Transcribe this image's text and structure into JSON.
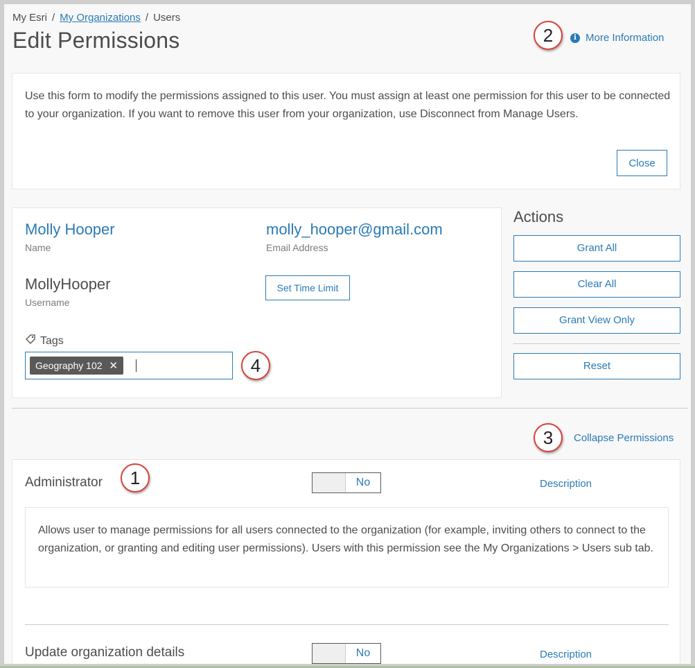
{
  "breadcrumb": {
    "items": [
      "My Esri",
      "My Organizations",
      "Users"
    ],
    "separator": "/"
  },
  "page_title": "Edit Permissions",
  "more_info": {
    "label": "More Information",
    "icon": "info-icon"
  },
  "callouts": {
    "c1": "1",
    "c2": "2",
    "c3": "3",
    "c4": "4"
  },
  "notice": {
    "text": "Use this form to modify the permissions assigned to this user. You must assign at least one permission for this user to be connected to your organization. If you want to remove this user from your organization, use Disconnect from Manage Users.",
    "close_label": "Close"
  },
  "user": {
    "name": "Molly Hooper",
    "name_label": "Name",
    "email": "molly_hooper@gmail.com",
    "email_label": "Email Address",
    "username": "MollyHooper",
    "username_label": "Username",
    "set_time_limit_label": "Set Time Limit",
    "tags_label": "Tags",
    "tags": [
      "Geography 102"
    ]
  },
  "actions": {
    "title": "Actions",
    "grant_all": "Grant All",
    "clear_all": "Clear All",
    "grant_view_only": "Grant View Only",
    "reset": "Reset"
  },
  "collapse_label": "Collapse Permissions",
  "permissions": [
    {
      "title": "Administrator",
      "value": "No",
      "description_link": "Description",
      "description": "Allows user to manage permissions for all users connected to the organization (for example, inviting others to connect to the organization, or granting and editing user permissions). Users with this permission see the My Organizations > Users sub tab."
    },
    {
      "title": "Update organization details",
      "value": "No",
      "description_link": "Description"
    }
  ],
  "colors": {
    "accent": "#2a7ab5",
    "text": "#4c4c4c",
    "callout_border": "#d9423a"
  }
}
